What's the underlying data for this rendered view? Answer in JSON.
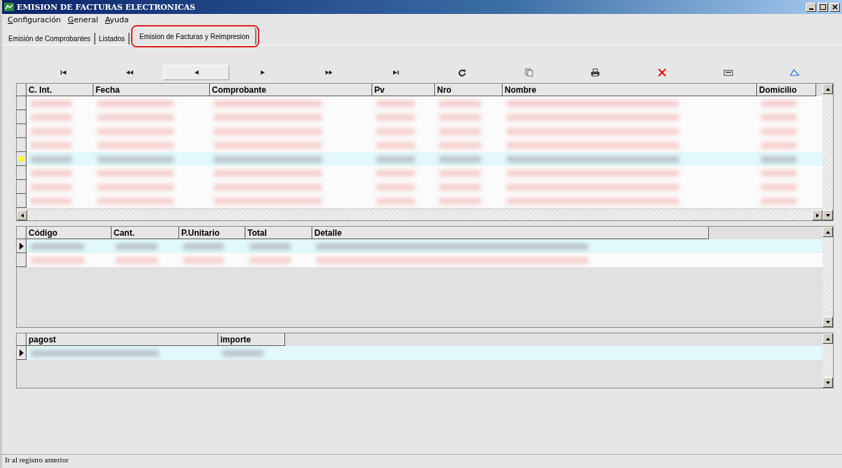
{
  "window": {
    "title": "EMISION DE FACTURAS ELECTRONICAS"
  },
  "menu": [
    {
      "label": "Configuración"
    },
    {
      "label": "General"
    },
    {
      "label": "Ayuda"
    }
  ],
  "tabs": [
    {
      "label": "Emisión de Comprobantes",
      "selected": false
    },
    {
      "label": "Listados",
      "selected": false
    },
    {
      "label": "Emision de Facturas y Reimpresion",
      "selected": true
    }
  ],
  "toolbar": [
    {
      "kind": "first",
      "selected": false
    },
    {
      "kind": "prev-page",
      "selected": false
    },
    {
      "kind": "prev",
      "selected": true
    },
    {
      "kind": "next",
      "selected": false
    },
    {
      "kind": "next-page",
      "selected": false
    },
    {
      "kind": "last",
      "selected": false
    },
    {
      "kind": "refresh",
      "selected": false
    },
    {
      "kind": "copy",
      "selected": false
    },
    {
      "kind": "print",
      "selected": false
    },
    {
      "kind": "delete",
      "selected": false
    },
    {
      "kind": "card",
      "selected": false
    },
    {
      "kind": "erase",
      "selected": false
    }
  ],
  "grids": [
    {
      "columns": [
        "C. Int.",
        "Fecha",
        "Comprobante",
        "Pv",
        "Nro",
        "Nombre",
        "Domicilio"
      ],
      "rows": [
        {
          "selected": false
        },
        {
          "selected": false
        },
        {
          "selected": false
        },
        {
          "selected": false
        },
        {
          "selected": true
        },
        {
          "selected": false
        },
        {
          "selected": false
        },
        {
          "selected": false
        }
      ]
    },
    {
      "columns": [
        "Código",
        "Cant.",
        "P.Unitario",
        "Total",
        "Detalle"
      ],
      "rows": [
        {
          "selected": true
        },
        {
          "selected": false
        }
      ]
    },
    {
      "columns": [
        "pagost",
        "importe"
      ],
      "rows": [
        {
          "selected": true
        }
      ]
    }
  ],
  "status_bar": "Ir al registro anterior"
}
